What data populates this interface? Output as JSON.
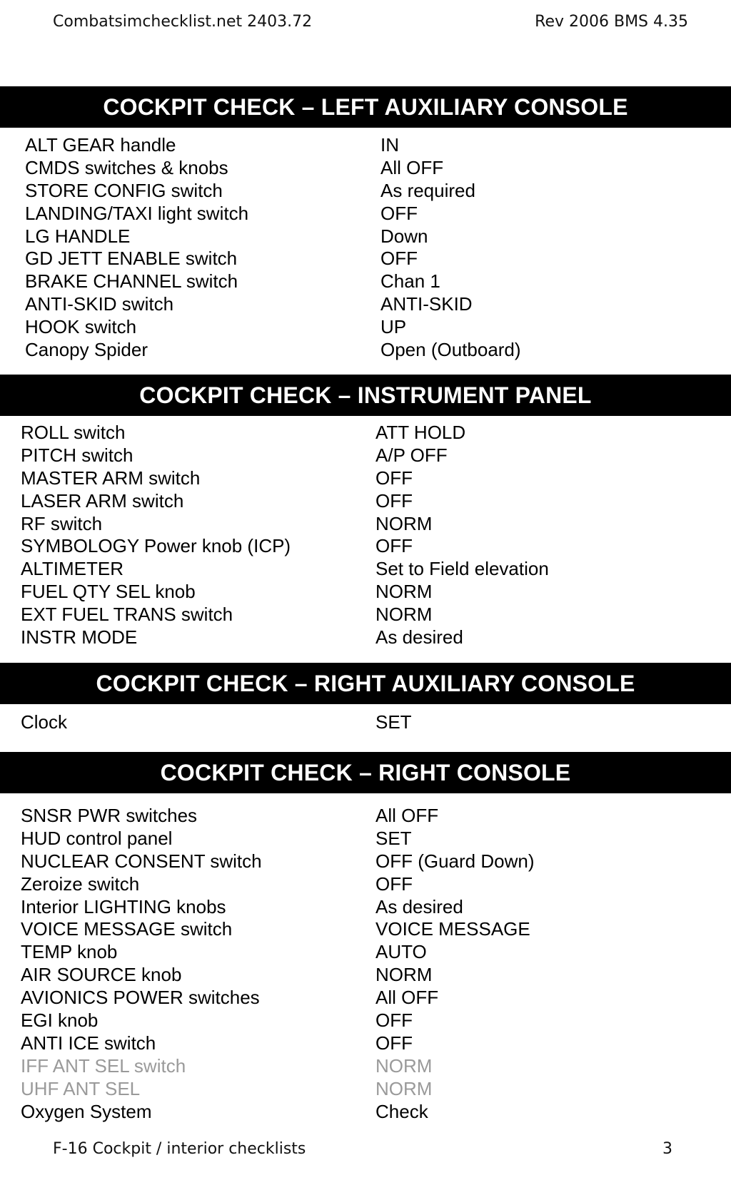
{
  "header": {
    "left": "Combatsimchecklist.net 2403.72",
    "right": "Rev 2006 BMS 4.35"
  },
  "footer": {
    "left": "F-16 Cockpit / interior checklists",
    "page": "3"
  },
  "sections": [
    {
      "title": "COCKPIT CHECK – LEFT AUXILIARY CONSOLE",
      "rows": [
        {
          "item": "ALT GEAR handle",
          "value": "IN"
        },
        {
          "item": "CMDS switches & knobs",
          "value": "All OFF"
        },
        {
          "item": "STORE CONFIG switch",
          "value": "As required"
        },
        {
          "item": "LANDING/TAXI light switch",
          "value": "OFF"
        },
        {
          "item": "LG HANDLE",
          "value": "Down"
        },
        {
          "item": "GD JETT ENABLE switch",
          "value": "OFF"
        },
        {
          "item": "BRAKE CHANNEL switch",
          "value": "Chan 1"
        },
        {
          "item": "ANTI-SKID switch",
          "value": "ANTI-SKID"
        },
        {
          "item": "HOOK switch",
          "value": "UP"
        },
        {
          "item": "Canopy Spider",
          "value": "Open (Outboard)"
        }
      ]
    },
    {
      "title": "COCKPIT CHECK – INSTRUMENT PANEL",
      "rows": [
        {
          "item": "ROLL switch",
          "value": "ATT HOLD"
        },
        {
          "item": "PITCH switch",
          "value": "A/P OFF"
        },
        {
          "item": "MASTER ARM switch",
          "value": "OFF"
        },
        {
          "item": "LASER ARM switch",
          "value": "OFF"
        },
        {
          "item": "RF switch",
          "value": "NORM"
        },
        {
          "item": "SYMBOLOGY Power knob (ICP)",
          "value": "OFF"
        },
        {
          "item": "ALTIMETER",
          "value": "Set to Field elevation"
        },
        {
          "item": "FUEL QTY SEL knob",
          "value": "NORM"
        },
        {
          "item": "EXT FUEL TRANS switch",
          "value": "NORM"
        },
        {
          "item": "INSTR MODE",
          "value": "As desired"
        }
      ]
    },
    {
      "title": "COCKPIT CHECK – RIGHT AUXILIARY CONSOLE",
      "rows": [
        {
          "item": "Clock",
          "value": "SET"
        }
      ]
    },
    {
      "title": "COCKPIT CHECK – RIGHT CONSOLE",
      "rows": [
        {
          "item": "SNSR PWR switches",
          "value": "All OFF"
        },
        {
          "item": "HUD control panel",
          "value": "SET"
        },
        {
          "item": "NUCLEAR CONSENT switch",
          "value": "OFF (Guard Down)"
        },
        {
          "item": "Zeroize switch",
          "value": "OFF"
        },
        {
          "item": "Interior LIGHTING knobs",
          "value": "As desired"
        },
        {
          "item": "VOICE MESSAGE switch",
          "value": "VOICE MESSAGE"
        },
        {
          "item": "TEMP knob",
          "value": "AUTO"
        },
        {
          "item": "AIR SOURCE knob",
          "value": "NORM"
        },
        {
          "item": "AVIONICS POWER switches",
          "value": "All OFF"
        },
        {
          "item": "EGI knob",
          "value": "OFF"
        },
        {
          "item": "ANTI ICE switch",
          "value": "OFF"
        },
        {
          "item": "IFF ANT SEL switch",
          "value": "NORM",
          "dimmed": true
        },
        {
          "item": "UHF ANT SEL",
          "value": "NORM",
          "dimmed": true
        },
        {
          "item": "Oxygen System",
          "value": "Check"
        }
      ]
    }
  ]
}
